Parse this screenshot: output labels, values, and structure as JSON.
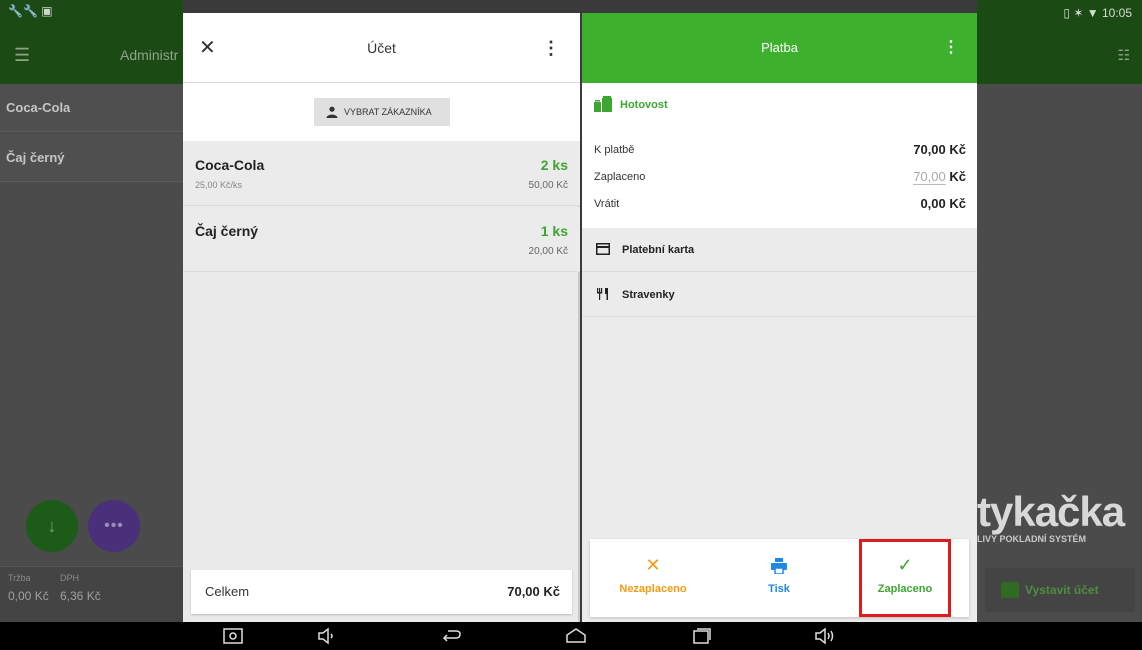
{
  "background": {
    "left_title": "Administr",
    "items": [
      "Coca-Cola",
      "Čaj černý"
    ],
    "fab_more": "•••",
    "bottom_labels": [
      "Tržba",
      "DPH"
    ],
    "bottom_values": [
      "0,00 Kč",
      "6,36 Kč"
    ],
    "status_time": "10:05",
    "logo": "tykačka",
    "tagline": "LIVÝ POKLADNÍ SYSTÉM",
    "issue_button": "Vystavit účet"
  },
  "ucet": {
    "title": "Účet",
    "customer_button": "VYBRAT ZÁKAZNÍKA",
    "items": [
      {
        "name": "Coca-Cola",
        "unit_price": "25,00 Kč/ks",
        "qty": "2 ks",
        "sum": "50,00 Kč"
      },
      {
        "name": "Čaj černý",
        "unit_price": "",
        "qty": "1 ks",
        "sum": "20,00 Kč"
      }
    ],
    "total_label": "Celkem",
    "total_value": "70,00 Kč"
  },
  "platba": {
    "title": "Platba",
    "cash": {
      "label": "Hotovost",
      "to_pay_label": "K platbě",
      "to_pay_value": "70,00 Kč",
      "paid_label": "Zaplaceno",
      "paid_amount": "70,00",
      "paid_currency": "Kč",
      "change_label": "Vrátit",
      "change_value": "0,00 Kč"
    },
    "methods": [
      "Platební karta",
      "Stravenky"
    ],
    "actions": {
      "unpaid": "Nezaplaceno",
      "print": "Tisk",
      "paid": "Zaplaceno"
    }
  },
  "colors": {
    "accent_green": "#3db02e",
    "orange": "#f39c12",
    "blue": "#1e88e5",
    "highlight_red": "#e01b1b"
  }
}
